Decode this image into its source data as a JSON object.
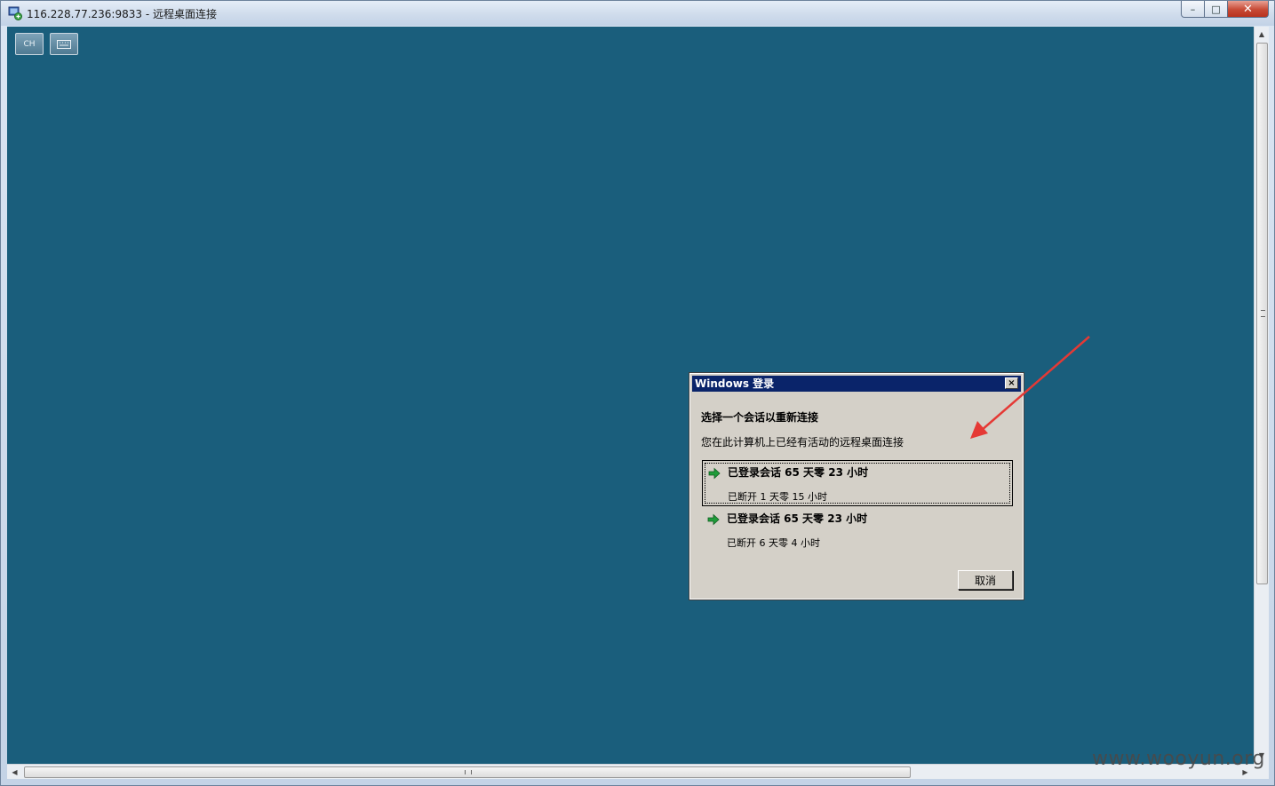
{
  "window": {
    "title": "116.228.77.236:9833 - 远程桌面连接",
    "min_label": "–",
    "max_label": "□",
    "close_label": "✕"
  },
  "toolbar": {
    "lang_label": "CH",
    "keyboard_icon": "keyboard-icon"
  },
  "dialog": {
    "title": "Windows 登录",
    "close_label": "×",
    "heading": "选择一个会话以重新连接",
    "description": "您在此计算机上已经有活动的远程桌面连接",
    "sessions": [
      {
        "title": "已登录会话 65 天零 23 小时",
        "status": "已断开 1 天零 15 小时",
        "selected": true
      },
      {
        "title": "已登录会话 65 天零 23 小时",
        "status": "已断开 6 天零 4 小时",
        "selected": false
      }
    ],
    "cancel_label": "取消"
  },
  "watermark": "www.wooyun.org",
  "colors": {
    "desktop": "#1a5e7c",
    "dialog_title": "#0a246a",
    "dialog_bg": "#d4d0c8",
    "annotation_arrow": "#e53935",
    "session_arrow": "#1f9c3a"
  }
}
